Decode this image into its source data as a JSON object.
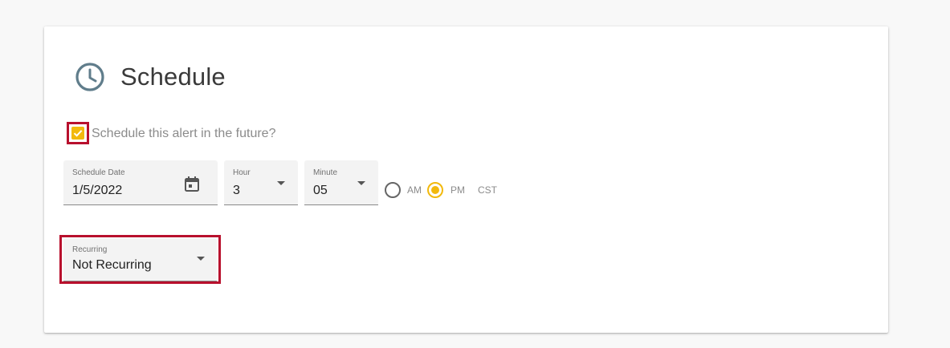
{
  "section": {
    "title": "Schedule",
    "icon": "clock-icon"
  },
  "schedule_checkbox": {
    "label": "Schedule this alert in the future?",
    "checked": true,
    "color": "#f2b90d"
  },
  "schedule_date": {
    "label": "Schedule Date",
    "value": "1/5/2022",
    "icon": "calendar-icon"
  },
  "hour": {
    "label": "Hour",
    "value": "3"
  },
  "minute": {
    "label": "Minute",
    "value": "05"
  },
  "meridiem": {
    "options": [
      "AM",
      "PM"
    ],
    "selected": "PM",
    "timezone": "CST"
  },
  "recurring": {
    "label": "Recurring",
    "value": "Not Recurring"
  },
  "colors": {
    "accent": "#f2b90d",
    "highlight": "#b8102d"
  }
}
